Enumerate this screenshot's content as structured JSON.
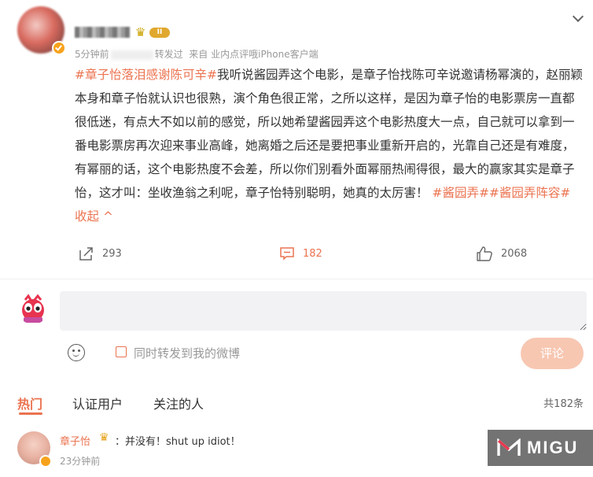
{
  "post": {
    "author_badge": "II",
    "meta": {
      "time": "5分钟前",
      "action": "转发过",
      "source": "来自 业内点评哦iPhone客户端"
    },
    "segments": [
      {
        "type": "tag",
        "text": "#章子怡落泪感谢陈可辛#"
      },
      {
        "type": "text",
        "text": "我听说酱园弄这个电影，是章子怡找陈可辛说邀请杨幂演的，赵丽颖本身和章子怡就认识也很熟，演个角色很正常，之所以这样，是因为章子怡的电影票房一直都很低迷，有点大不如以前的感觉，所以她希望酱园弄这个电影热度大一点，自己就可以拿到一番电影票房再次迎来事业高峰，她离婚之后还是要把事业重新开启的，光靠自己还是有难度，有幂丽的话，这个电影热度不会差，所以你们别看外面幂丽热闹得很，最大的赢家其实是章子怡，这才叫：坐收渔翁之利呢，章子怡特别聪明，她真的太厉害！"
      },
      {
        "type": "tag",
        "text": "#酱园弄##酱园弄阵容#"
      },
      {
        "type": "collapse",
        "text": " 收起"
      }
    ],
    "actions": {
      "repost_count": "293",
      "comment_count": "182",
      "like_count": "2068"
    }
  },
  "composer": {
    "placeholder": "",
    "also_repost_label": "同时转发到我的微博",
    "submit_label": "评论"
  },
  "comment_tabs": {
    "tabs": [
      "热门",
      "认证用户",
      "关注的人"
    ],
    "total": "共182条"
  },
  "hot_comment": {
    "user": "章子怡",
    "text": "：并没有！shut up idiot！",
    "time": "23分钟前"
  },
  "watermark": {
    "text": "MIGU"
  },
  "colors": {
    "accent": "#eb7350",
    "submit_disabled": "#f7c7b2",
    "badge_gold": "#e0a82e"
  }
}
